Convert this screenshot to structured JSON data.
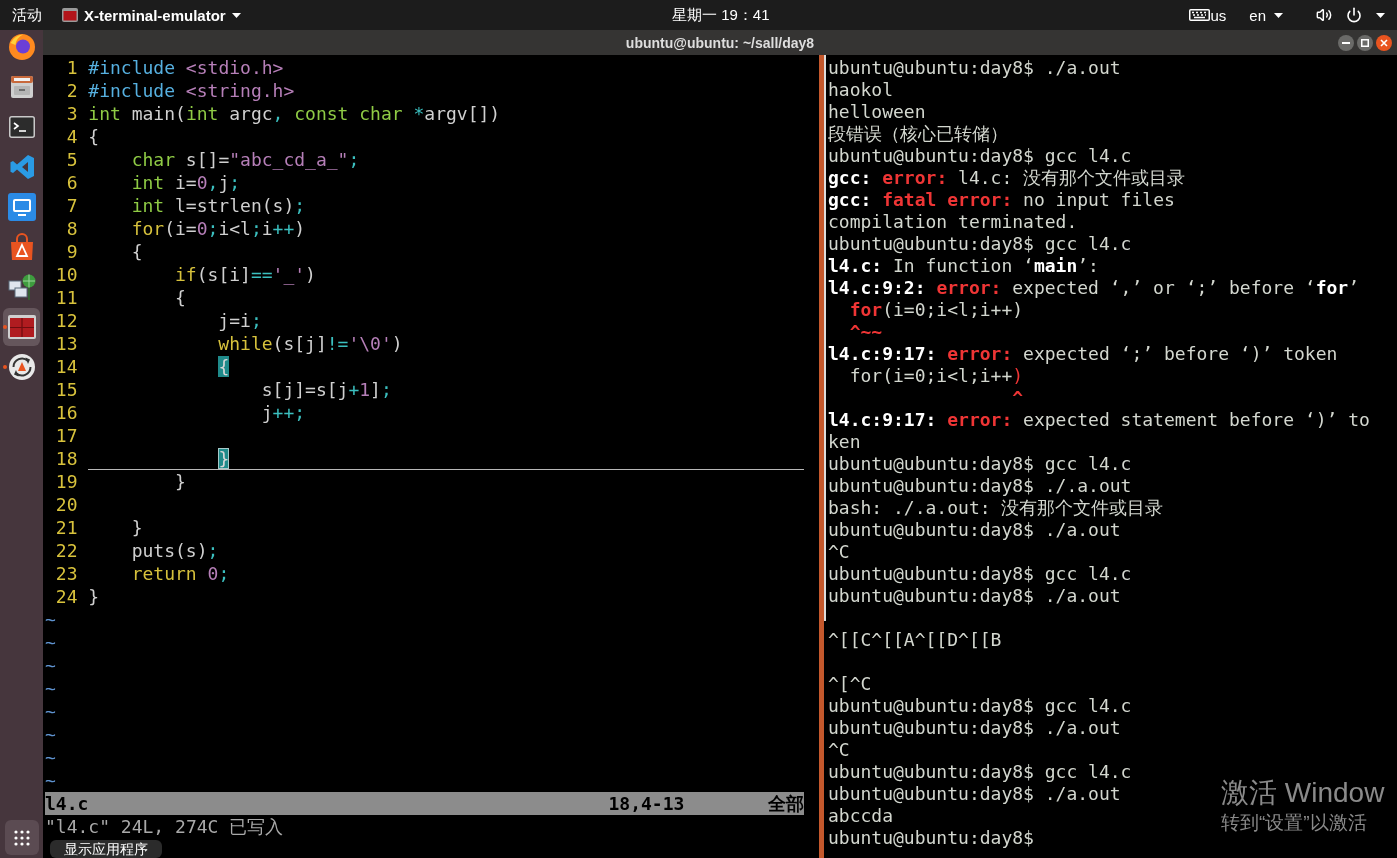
{
  "top_bar": {
    "activities": "活动",
    "app_menu": {
      "label": "X-terminal-emulator"
    },
    "clock": "星期一 19：41",
    "keyboard_layout": "us",
    "language": "en"
  },
  "dock": {
    "items": [
      {
        "kind": "browser",
        "running": false,
        "selected": false
      },
      {
        "kind": "files",
        "running": false,
        "selected": false
      },
      {
        "kind": "terminal",
        "running": false,
        "selected": false
      },
      {
        "kind": "code-editor",
        "running": false,
        "selected": false
      },
      {
        "kind": "remote-viewer",
        "running": false,
        "selected": false
      },
      {
        "kind": "store",
        "running": false,
        "selected": false
      },
      {
        "kind": "network",
        "running": false,
        "selected": false
      },
      {
        "kind": "split-terminal",
        "running": true,
        "selected": true
      },
      {
        "kind": "updater",
        "running": true,
        "selected": false
      }
    ],
    "tooltip": "显示应用程序"
  },
  "window": {
    "title": "ubuntu@ubuntu: ~/sall/day8"
  },
  "editor": {
    "lines": [
      {
        "number": "1",
        "current": false,
        "segments": [
          {
            "text": "#include",
            "kind": "preproc"
          },
          {
            "text": " <stdio.h>",
            "kind": "string"
          }
        ]
      },
      {
        "number": "2",
        "current": false,
        "segments": [
          {
            "text": "#include",
            "kind": "preproc"
          },
          {
            "text": " <string.h>",
            "kind": "string"
          }
        ]
      },
      {
        "number": "3",
        "current": false,
        "segments": [
          {
            "text": "int",
            "kind": "type"
          },
          {
            "text": " main(",
            "kind": "plain"
          },
          {
            "text": "int",
            "kind": "type"
          },
          {
            "text": " argc",
            "kind": "plain"
          },
          {
            "text": ",",
            "kind": "operator"
          },
          {
            "text": " const char",
            "kind": "type"
          },
          {
            "text": " *",
            "kind": "operator"
          },
          {
            "text": "argv[])",
            "kind": "plain"
          }
        ]
      },
      {
        "number": "4",
        "current": false,
        "segments": [
          {
            "text": "{",
            "kind": "plain"
          }
        ]
      },
      {
        "number": "5",
        "current": false,
        "segments": [
          {
            "text": "    char",
            "kind": "type"
          },
          {
            "text": " s[]=",
            "kind": "plain"
          },
          {
            "text": "\"abc_cd_a_\"",
            "kind": "string"
          },
          {
            "text": ";",
            "kind": "operator"
          }
        ]
      },
      {
        "number": "6",
        "current": false,
        "segments": [
          {
            "text": "    int",
            "kind": "type"
          },
          {
            "text": " i=",
            "kind": "plain"
          },
          {
            "text": "0",
            "kind": "number"
          },
          {
            "text": ",",
            "kind": "operator"
          },
          {
            "text": "j",
            "kind": "plain"
          },
          {
            "text": ";",
            "kind": "operator"
          }
        ]
      },
      {
        "number": "7",
        "current": false,
        "segments": [
          {
            "text": "    int",
            "kind": "type"
          },
          {
            "text": " l=strlen(s)",
            "kind": "plain"
          },
          {
            "text": ";",
            "kind": "operator"
          }
        ]
      },
      {
        "number": "8",
        "current": false,
        "segments": [
          {
            "text": "    for",
            "kind": "statement"
          },
          {
            "text": "(i=",
            "kind": "plain"
          },
          {
            "text": "0",
            "kind": "number"
          },
          {
            "text": ";",
            "kind": "operator"
          },
          {
            "text": "i<l",
            "kind": "plain"
          },
          {
            "text": ";",
            "kind": "operator"
          },
          {
            "text": "i",
            "kind": "plain"
          },
          {
            "text": "++",
            "kind": "operator"
          },
          {
            "text": ")",
            "kind": "plain"
          }
        ]
      },
      {
        "number": "9",
        "current": false,
        "segments": [
          {
            "text": "    {",
            "kind": "plain"
          }
        ]
      },
      {
        "number": "10",
        "current": false,
        "segments": [
          {
            "text": "        if",
            "kind": "statement"
          },
          {
            "text": "(s[i]",
            "kind": "plain"
          },
          {
            "text": "==",
            "kind": "operator"
          },
          {
            "text": "'_'",
            "kind": "string"
          },
          {
            "text": ")",
            "kind": "plain"
          }
        ]
      },
      {
        "number": "11",
        "current": false,
        "segments": [
          {
            "text": "        {",
            "kind": "plain"
          }
        ]
      },
      {
        "number": "12",
        "current": false,
        "segments": [
          {
            "text": "            j=i",
            "kind": "plain"
          },
          {
            "text": ";",
            "kind": "operator"
          }
        ]
      },
      {
        "number": "13",
        "current": false,
        "segments": [
          {
            "text": "            while",
            "kind": "statement"
          },
          {
            "text": "(s[j]",
            "kind": "plain"
          },
          {
            "text": "!=",
            "kind": "operator"
          },
          {
            "text": "'\\0'",
            "kind": "string"
          },
          {
            "text": ")",
            "kind": "plain"
          }
        ]
      },
      {
        "number": "14",
        "current": false,
        "segments": [
          {
            "text": "            {",
            "kind": "match"
          }
        ]
      },
      {
        "number": "15",
        "current": false,
        "segments": [
          {
            "text": "                s[j]=s[j",
            "kind": "plain"
          },
          {
            "text": "+",
            "kind": "operator"
          },
          {
            "text": "1",
            "kind": "number"
          },
          {
            "text": "]",
            "kind": "plain"
          },
          {
            "text": ";",
            "kind": "operator"
          }
        ]
      },
      {
        "number": "16",
        "current": false,
        "segments": [
          {
            "text": "                j",
            "kind": "plain"
          },
          {
            "text": "++;",
            "kind": "operator"
          }
        ]
      },
      {
        "number": "17",
        "current": false
      },
      {
        "number": "18",
        "current": true,
        "segments": [
          {
            "text": "            }",
            "kind": "cursor"
          }
        ]
      },
      {
        "number": "19",
        "current": false,
        "segments": [
          {
            "text": "        }",
            "kind": "plain"
          }
        ]
      },
      {
        "number": "20",
        "current": false
      },
      {
        "number": "21",
        "current": false,
        "segments": [
          {
            "text": "    }",
            "kind": "plain"
          }
        ]
      },
      {
        "number": "22",
        "current": false,
        "segments": [
          {
            "text": "    puts(s)",
            "kind": "plain"
          },
          {
            "text": ";",
            "kind": "operator"
          }
        ]
      },
      {
        "number": "23",
        "current": false,
        "segments": [
          {
            "text": "    return",
            "kind": "statement"
          },
          {
            "text": " 0",
            "kind": "number"
          },
          {
            "text": ";",
            "kind": "operator"
          }
        ]
      },
      {
        "number": "24",
        "current": false,
        "segments": [
          {
            "text": "}",
            "kind": "plain"
          }
        ]
      }
    ],
    "empty_rows": [
      "~",
      "~",
      "~",
      "~",
      "~",
      "~",
      "~",
      "~"
    ],
    "status": {
      "file": "l4.c",
      "position": "18,4-13",
      "scroll": "全部"
    },
    "message": "\"l4.c\" 24L, 274C 已写入"
  },
  "terminal": {
    "lines": [
      {
        "kind": "output",
        "segments": [
          {
            "text": "ubuntu@ubuntu:day8$ ./a.out",
            "kind": "plain"
          }
        ]
      },
      {
        "kind": "output",
        "segments": [
          {
            "text": "haokol",
            "kind": "plain"
          }
        ]
      },
      {
        "kind": "output",
        "segments": [
          {
            "text": "helloween",
            "kind": "plain"
          }
        ]
      },
      {
        "kind": "output",
        "segments": [
          {
            "text": "段错误（核心已转储）",
            "kind": "plain"
          }
        ]
      },
      {
        "kind": "output",
        "segments": [
          {
            "text": "ubuntu@ubuntu:day8$ gcc l4.c",
            "kind": "plain"
          }
        ]
      },
      {
        "kind": "output",
        "segments": [
          {
            "text": "gcc:",
            "kind": "bold"
          },
          {
            "text": " error:",
            "kind": "error"
          },
          {
            "text": " l4.c: 没有那个文件或目录",
            "kind": "plain"
          }
        ]
      },
      {
        "kind": "output",
        "segments": [
          {
            "text": "gcc:",
            "kind": "bold"
          },
          {
            "text": " fatal error:",
            "kind": "error"
          },
          {
            "text": " no input files",
            "kind": "plain"
          }
        ]
      },
      {
        "kind": "output",
        "segments": [
          {
            "text": "compilation terminated.",
            "kind": "plain"
          }
        ]
      },
      {
        "kind": "output",
        "segments": [
          {
            "text": "ubuntu@ubuntu:day8$ gcc l4.c",
            "kind": "plain"
          }
        ]
      },
      {
        "kind": "output",
        "segments": [
          {
            "text": "l4.c:",
            "kind": "bold"
          },
          {
            "text": " In function ‘",
            "kind": "plain"
          },
          {
            "text": "main",
            "kind": "bold"
          },
          {
            "text": "’:",
            "kind": "plain"
          }
        ]
      },
      {
        "kind": "output",
        "segments": [
          {
            "text": "l4.c:9:2:",
            "kind": "bold"
          },
          {
            "text": " error:",
            "kind": "error"
          },
          {
            "text": " expected ‘,’ or ‘;’ before ‘",
            "kind": "plain"
          },
          {
            "text": "for",
            "kind": "bold"
          },
          {
            "text": "’",
            "kind": "plain"
          }
        ]
      },
      {
        "kind": "output",
        "segments": [
          {
            "text": "  for",
            "kind": "error"
          },
          {
            "text": "(i=0;i<l;i++)",
            "kind": "plain"
          }
        ]
      },
      {
        "kind": "output",
        "segments": [
          {
            "text": "  ^~~",
            "kind": "error"
          }
        ]
      },
      {
        "kind": "output",
        "segments": [
          {
            "text": "l4.c:9:17:",
            "kind": "bold"
          },
          {
            "text": " error:",
            "kind": "error"
          },
          {
            "text": " expected ‘;’ before ‘)’ token",
            "kind": "plain"
          }
        ]
      },
      {
        "kind": "output",
        "segments": [
          {
            "text": "  for(i=0;i<l;i++",
            "kind": "plain"
          },
          {
            "text": ")",
            "kind": "mark"
          }
        ]
      },
      {
        "kind": "output",
        "segments": [
          {
            "text": "                 ^",
            "kind": "error"
          }
        ]
      },
      {
        "kind": "output",
        "segments": [
          {
            "text": "l4.c:9:17:",
            "kind": "bold"
          },
          {
            "text": " error:",
            "kind": "error"
          },
          {
            "text": " expected statement before ‘)’ to",
            "kind": "plain"
          }
        ]
      },
      {
        "kind": "output",
        "segments": [
          {
            "text": "ken",
            "kind": "plain"
          }
        ]
      },
      {
        "kind": "output",
        "segments": [
          {
            "text": "ubuntu@ubuntu:day8$ gcc l4.c",
            "kind": "plain"
          }
        ]
      },
      {
        "kind": "output",
        "segments": [
          {
            "text": "ubuntu@ubuntu:day8$ ./.a.out",
            "kind": "plain"
          }
        ]
      },
      {
        "kind": "output",
        "segments": [
          {
            "text": "bash: ./.a.out: 没有那个文件或目录",
            "kind": "plain"
          }
        ]
      },
      {
        "kind": "output",
        "segments": [
          {
            "text": "ubuntu@ubuntu:day8$ ./a.out",
            "kind": "plain"
          }
        ]
      },
      {
        "kind": "output",
        "segments": [
          {
            "text": "^C",
            "kind": "plain"
          }
        ]
      },
      {
        "kind": "output",
        "segments": [
          {
            "text": "ubuntu@ubuntu:day8$ gcc l4.c",
            "kind": "plain"
          }
        ]
      },
      {
        "kind": "output",
        "segments": [
          {
            "text": "ubuntu@ubuntu:day8$ ./a.out",
            "kind": "plain"
          }
        ]
      },
      {
        "kind": "blank"
      },
      {
        "kind": "output",
        "segments": [
          {
            "text": "^[[C^[[A^[[D^[[B",
            "kind": "plain"
          }
        ]
      },
      {
        "kind": "blank"
      },
      {
        "kind": "output",
        "segments": [
          {
            "text": "^[^C",
            "kind": "plain"
          }
        ]
      },
      {
        "kind": "output",
        "segments": [
          {
            "text": "ubuntu@ubuntu:day8$ gcc l4.c",
            "kind": "plain"
          }
        ]
      },
      {
        "kind": "output",
        "segments": [
          {
            "text": "ubuntu@ubuntu:day8$ ./a.out",
            "kind": "plain"
          }
        ]
      },
      {
        "kind": "output",
        "segments": [
          {
            "text": "^C",
            "kind": "plain"
          }
        ]
      },
      {
        "kind": "output",
        "segments": [
          {
            "text": "ubuntu@ubuntu:day8$ gcc l4.c",
            "kind": "plain"
          }
        ]
      },
      {
        "kind": "output",
        "segments": [
          {
            "text": "ubuntu@ubuntu:day8$ ./a.out",
            "kind": "plain"
          }
        ]
      },
      {
        "kind": "output",
        "segments": [
          {
            "text": "abccda",
            "kind": "plain"
          }
        ]
      },
      {
        "kind": "output",
        "segments": [
          {
            "text": "ubuntu@ubuntu:day8$",
            "kind": "plain"
          }
        ]
      }
    ]
  },
  "activation_notice": {
    "title": "激活 Window",
    "subtitle": "转到“设置”以激活"
  }
}
